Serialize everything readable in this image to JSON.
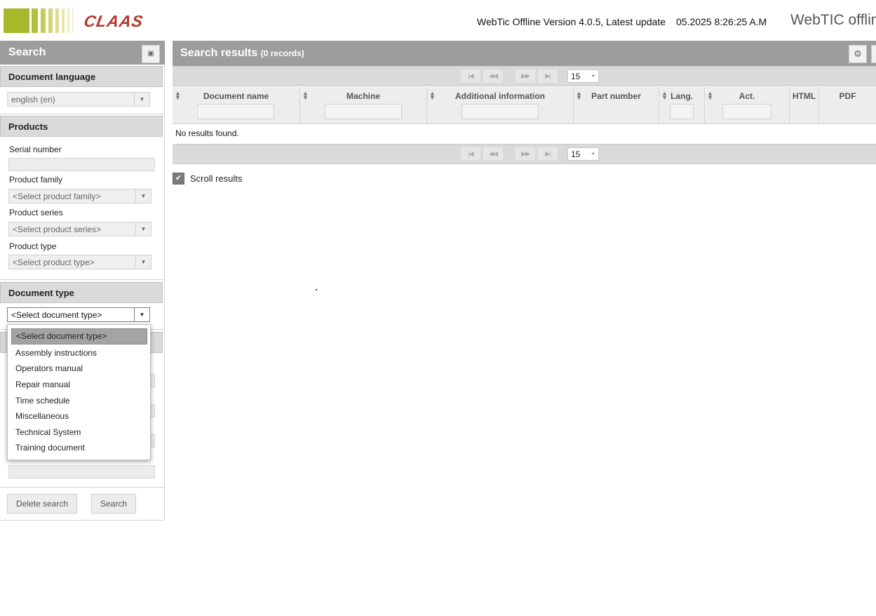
{
  "header": {
    "logo_text": "CLAAS",
    "version_text": "WebTic Offline Version 4.0.5, Latest update",
    "datetime": "05.2025 8:26:25 A.M",
    "brand": "WebTIC offline",
    "logo_bar_colors": [
      "#a7b92a",
      "#c1cb4f",
      "#d0d56d",
      "#dfdf8f",
      "#e7e6a8",
      "#efedc0"
    ]
  },
  "search_panel": {
    "title": "Search",
    "document_language": {
      "heading": "Document language",
      "selected": "english (en)"
    },
    "products": {
      "heading": "Products",
      "serial_label": "Serial number",
      "family_label": "Product family",
      "family_selected": "<Select product family>",
      "series_label": "Product series",
      "series_selected": "<Select product series>",
      "type_label": "Product type",
      "type_selected": "<Select product type>"
    },
    "document_type": {
      "heading": "Document type",
      "selected": "<Select document type>",
      "options": [
        "<Select document type>",
        "Assembly instructions",
        "Operators manual",
        "Repair manual",
        "Time schedule",
        "Miscellaneous",
        "Technical System",
        "Training document"
      ]
    },
    "buttons": {
      "delete": "Delete search",
      "search": "Search"
    }
  },
  "results": {
    "title": "Search results",
    "count": "(0 records)",
    "page_size": "15",
    "columns": [
      "Document name",
      "Machine",
      "Additional information",
      "Part number",
      "Lang.",
      "Act.",
      "HTML",
      "PDF"
    ],
    "empty_message": "No results found.",
    "scroll_label": "Scroll results",
    "scroll_checked": true
  }
}
